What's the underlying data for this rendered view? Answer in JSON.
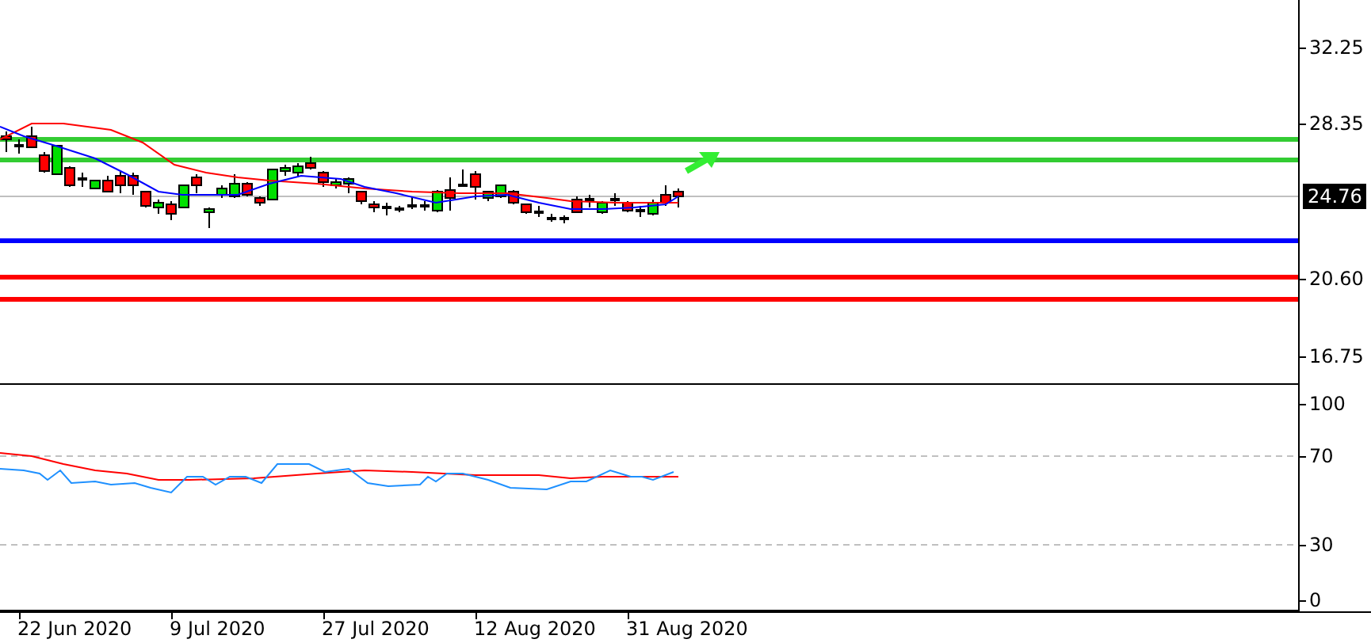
{
  "price_axis": {
    "labels": [
      "32.25",
      "28.35",
      "20.60",
      "16.75"
    ],
    "current_price": "24.76"
  },
  "levels": [
    {
      "color": "#33cc33"
    },
    {
      "color": "#33cc33"
    },
    {
      "color": "#0000ff"
    },
    {
      "color": "#ff0000"
    },
    {
      "color": "#ff0000"
    }
  ],
  "oscillator_axis": {
    "labels": [
      "100",
      "70",
      "30",
      "0"
    ]
  },
  "time_axis": {
    "labels": [
      "22 Jun 2020",
      "9 Jul 2020",
      "27 Jul 2020",
      "12 Aug 2020",
      "31 Aug 2020"
    ]
  }
}
